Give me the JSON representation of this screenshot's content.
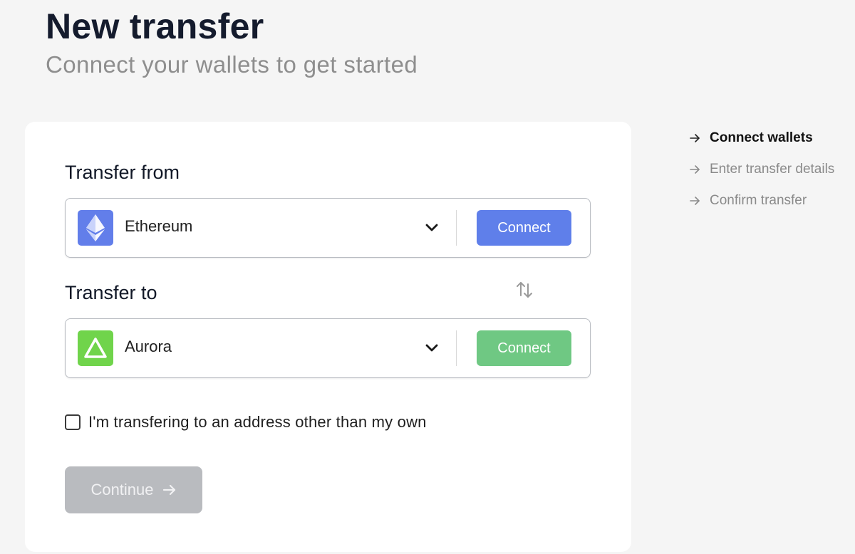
{
  "header": {
    "title": "New transfer",
    "subtitle": "Connect your wallets to get started"
  },
  "form": {
    "from_label": "Transfer from",
    "to_label": "Transfer to",
    "from": {
      "chain": "Ethereum",
      "icon": "ethereum-icon",
      "connect_label": "Connect",
      "accent": "#5f7fea"
    },
    "to": {
      "chain": "Aurora",
      "icon": "aurora-icon",
      "connect_label": "Connect",
      "accent": "#6fc883"
    },
    "other_address_label": "I'm transfering to an address other than my own",
    "other_address_checked": false,
    "continue_label": "Continue"
  },
  "steps": [
    {
      "label": "Connect wallets",
      "active": true
    },
    {
      "label": "Enter transfer details",
      "active": false
    },
    {
      "label": "Confirm transfer",
      "active": false
    }
  ]
}
